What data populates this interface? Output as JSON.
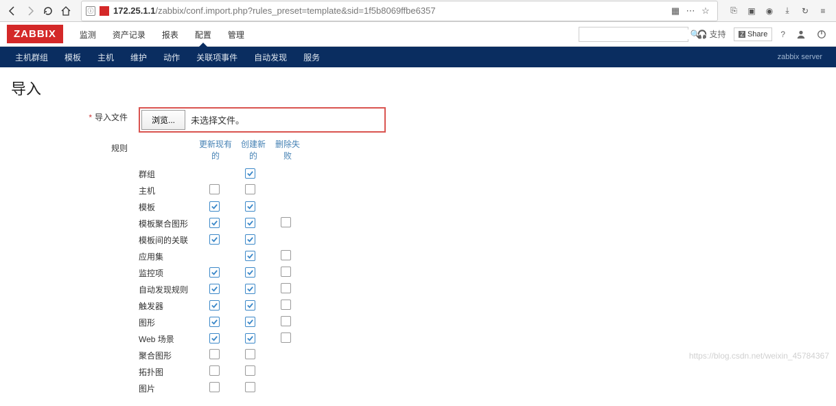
{
  "browser": {
    "url_host": "172.25.1.1",
    "url_path": "/zabbix/conf.import.php?rules_preset=template&sid=1f5b8069ffbe6357"
  },
  "header": {
    "logo": "ZABBIX",
    "support_label": "支持",
    "share_label": "Share",
    "help_label": "?",
    "search_placeholder": ""
  },
  "main_nav": [
    {
      "label": "监测"
    },
    {
      "label": "资产记录"
    },
    {
      "label": "报表"
    },
    {
      "label": "配置",
      "active": true
    },
    {
      "label": "管理"
    }
  ],
  "sub_nav": {
    "items": [
      {
        "label": "主机群组"
      },
      {
        "label": "模板"
      },
      {
        "label": "主机"
      },
      {
        "label": "维护"
      },
      {
        "label": "动作"
      },
      {
        "label": "关联项事件"
      },
      {
        "label": "自动发现"
      },
      {
        "label": "服务"
      }
    ],
    "server": "zabbix server"
  },
  "page": {
    "title": "导入",
    "file_label": "导入文件",
    "browse_btn": "浏览...",
    "file_status": "未选择文件。",
    "rules_label": "规则"
  },
  "rules_headers": {
    "update": "更新现有的",
    "create": "创建新的",
    "delete": "删除失败"
  },
  "rules": [
    {
      "name": "群组",
      "update": null,
      "create": true,
      "delete": null
    },
    {
      "name": "主机",
      "update": false,
      "create": false,
      "delete": null
    },
    {
      "name": "模板",
      "update": true,
      "create": true,
      "delete": null
    },
    {
      "name": "模板聚合图形",
      "update": true,
      "create": true,
      "delete": false
    },
    {
      "name": "模板间的关联",
      "update": true,
      "create": true,
      "delete": null
    },
    {
      "name": "应用集",
      "update": null,
      "create": true,
      "delete": false
    },
    {
      "name": "监控项",
      "update": true,
      "create": true,
      "delete": false
    },
    {
      "name": "自动发现规则",
      "update": true,
      "create": true,
      "delete": false
    },
    {
      "name": "触发器",
      "update": true,
      "create": true,
      "delete": false
    },
    {
      "name": "图形",
      "update": true,
      "create": true,
      "delete": false
    },
    {
      "name": "Web 场景",
      "update": true,
      "create": true,
      "delete": false
    },
    {
      "name": "聚合图形",
      "update": false,
      "create": false,
      "delete": null
    },
    {
      "name": "拓扑图",
      "update": false,
      "create": false,
      "delete": null
    },
    {
      "name": "图片",
      "update": false,
      "create": false,
      "delete": null
    }
  ],
  "watermark": "https://blog.csdn.net/weixin_45784367"
}
